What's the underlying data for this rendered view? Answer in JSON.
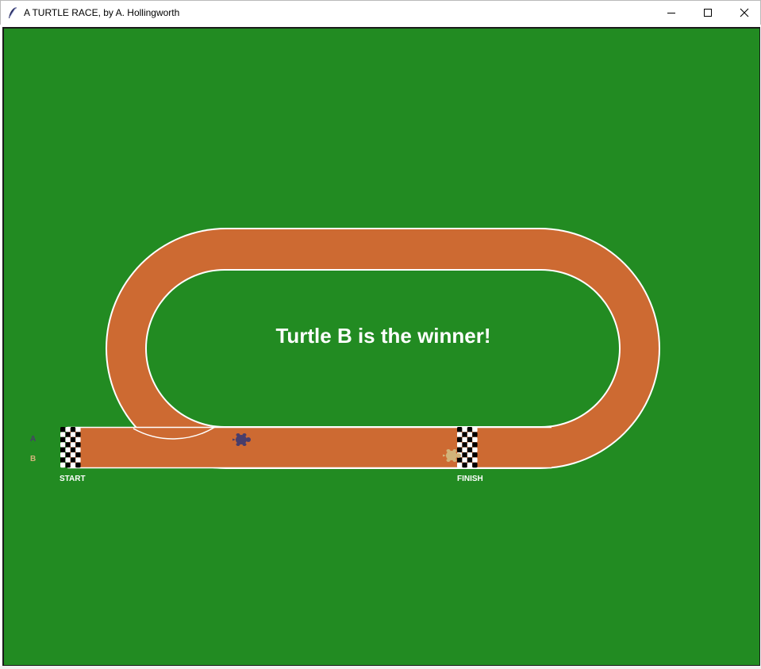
{
  "window": {
    "title": "A TURTLE RACE, by A. Hollingworth",
    "app_icon": "feather-icon",
    "controls": [
      "minimize-icon",
      "maximize-icon",
      "close-icon"
    ]
  },
  "game": {
    "winner_message": "Turtle B is the winner!",
    "start_label": "START",
    "finish_label": "FINISH",
    "lanes": [
      {
        "label": "A",
        "color": "#483d6b"
      },
      {
        "label": "B",
        "color": "#d2b47a"
      }
    ],
    "colors": {
      "field": "#228b22",
      "track": "#cd6a32",
      "track_edge": "#ffffff",
      "flag_dark": "#000000",
      "flag_light": "#ffffff"
    }
  }
}
